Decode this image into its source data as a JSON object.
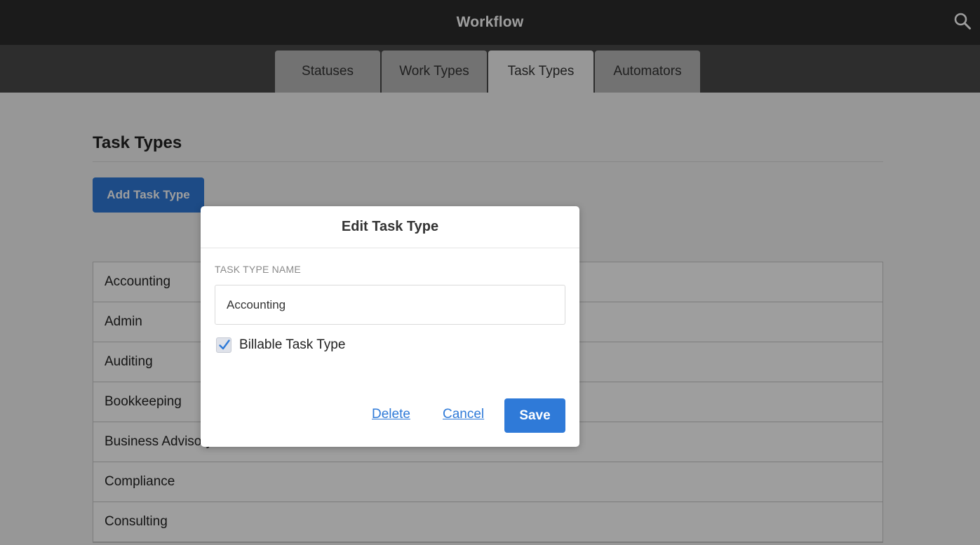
{
  "header": {
    "title": "Workflow",
    "search_icon": "search-icon"
  },
  "tabs": [
    {
      "label": "Statuses",
      "active": false
    },
    {
      "label": "Work Types",
      "active": false
    },
    {
      "label": "Task Types",
      "active": true
    },
    {
      "label": "Automators",
      "active": false
    }
  ],
  "main": {
    "title": "Task Types",
    "add_button_label": "Add Task Type",
    "items": [
      "Accounting",
      "Admin",
      "Auditing",
      "Bookkeeping",
      "Business Advisory",
      "Compliance",
      "Consulting"
    ]
  },
  "modal": {
    "title": "Edit Task Type",
    "field_label": "TASK TYPE NAME",
    "name_value": "Accounting",
    "billable_label": "Billable Task Type",
    "billable_checked": true,
    "delete_label": "Delete",
    "cancel_label": "Cancel",
    "save_label": "Save"
  },
  "colors": {
    "accent": "#2f7ad8",
    "header_bg": "#2c2c2c",
    "tabbar_bg": "#4a4a4a"
  }
}
